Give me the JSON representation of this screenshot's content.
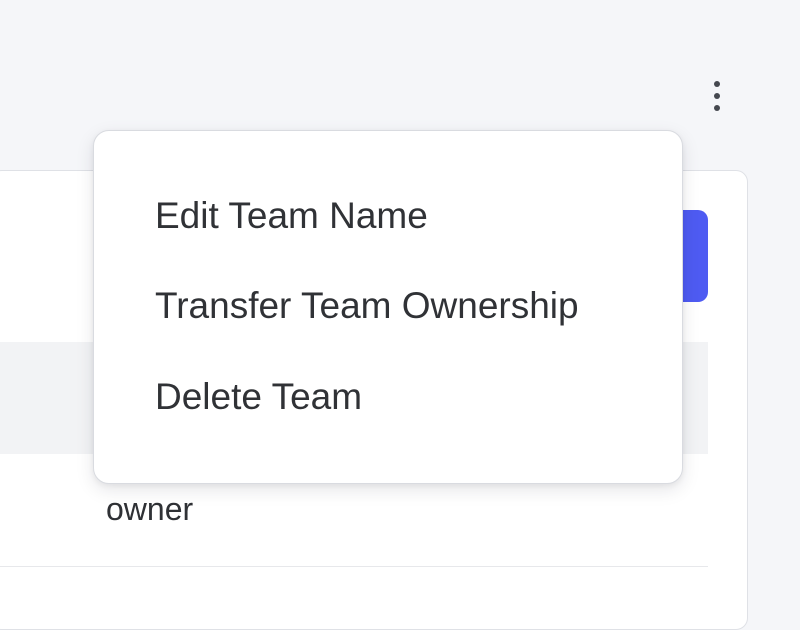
{
  "menu": {
    "items": [
      {
        "label": "Edit Team Name"
      },
      {
        "label": "Transfer Team Ownership"
      },
      {
        "label": "Delete Team"
      }
    ]
  },
  "table": {
    "rows": [
      {
        "role": "owner"
      }
    ]
  },
  "icons": {
    "more": "more-vertical-icon"
  },
  "colors": {
    "page_background": "#f5f6f9",
    "primary_button": "#4e5bf2",
    "menu_background": "#ffffff",
    "text": "#303236"
  }
}
